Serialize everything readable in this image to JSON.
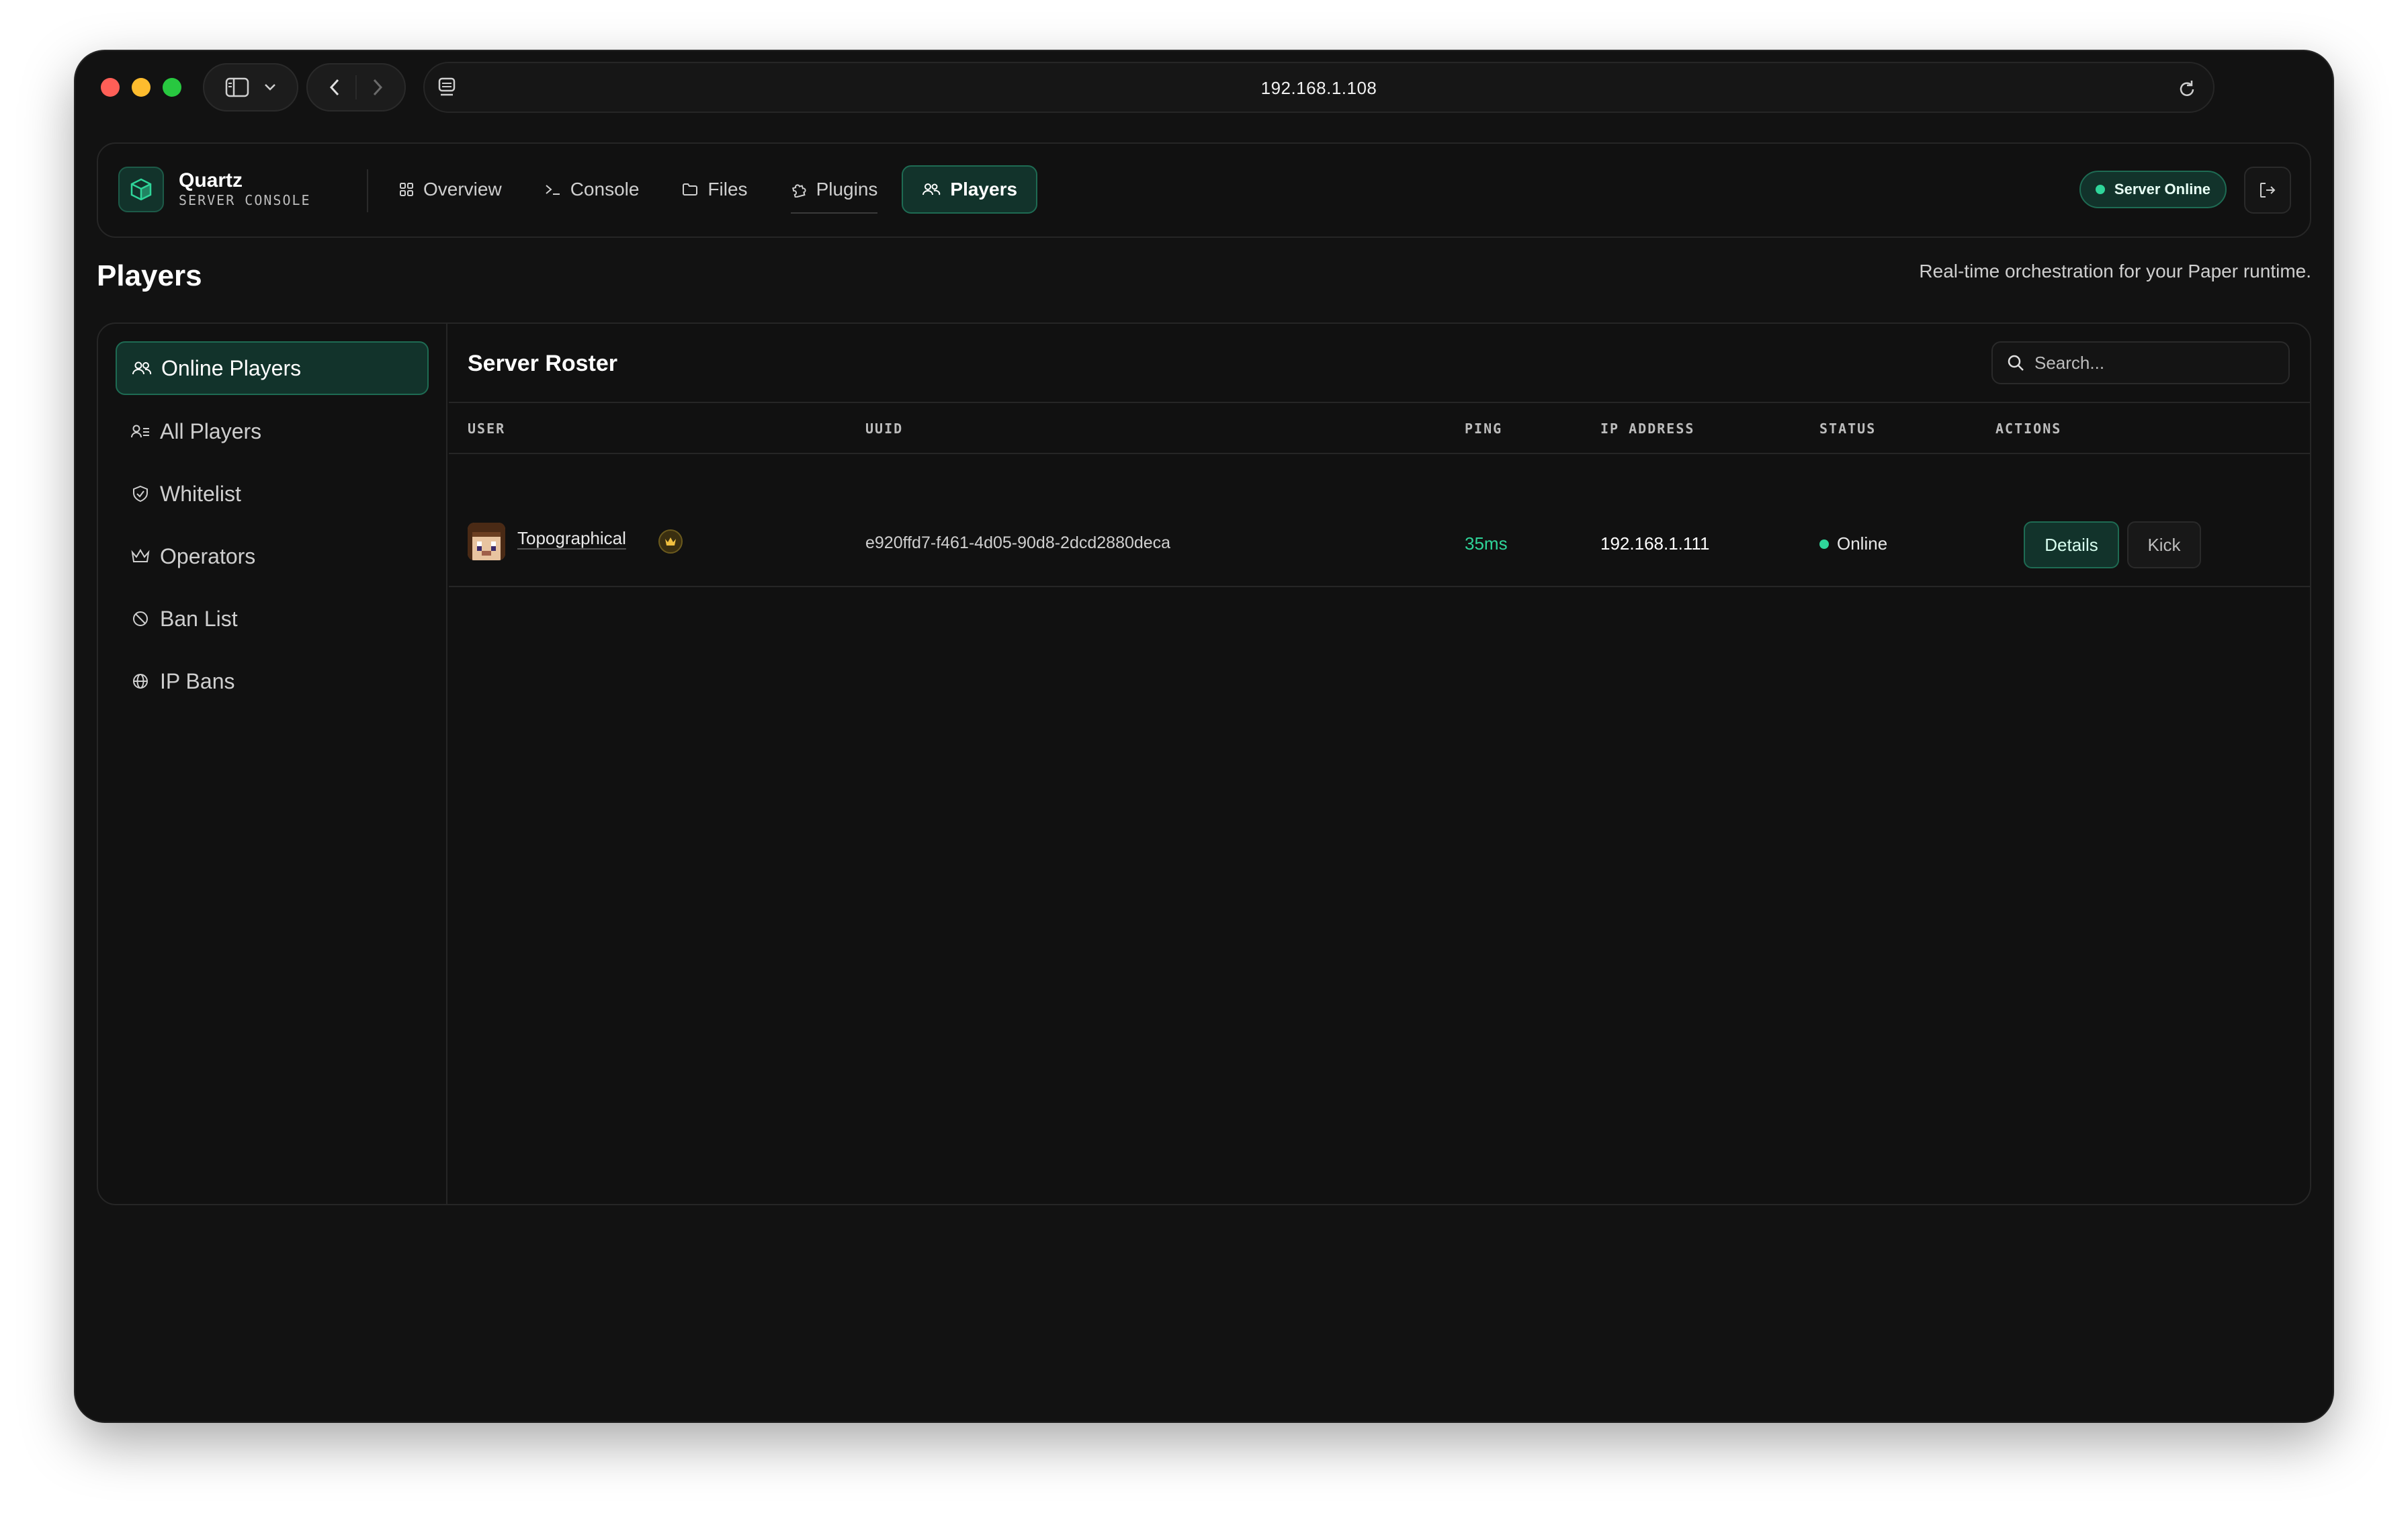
{
  "browser": {
    "address": "192.168.1.108"
  },
  "app": {
    "brand_title": "Quartz",
    "brand_subtitle": "SERVER CONSOLE",
    "nav": [
      {
        "label": "Overview",
        "icon": "grid-icon"
      },
      {
        "label": "Console",
        "icon": "terminal-icon"
      },
      {
        "label": "Files",
        "icon": "folder-icon"
      },
      {
        "label": "Plugins",
        "icon": "puzzle-icon"
      },
      {
        "label": "Players",
        "icon": "users-icon",
        "active": true
      }
    ],
    "server_status": "Server Online",
    "status_color": "#2fd59a",
    "accent_color": "#1e6b53"
  },
  "page": {
    "title": "Players",
    "description": "Real-time orchestration for your Paper runtime."
  },
  "sidebar": {
    "items": [
      {
        "label": "Online Players",
        "icon": "users-icon",
        "active": true
      },
      {
        "label": "All Players",
        "icon": "user-list-icon"
      },
      {
        "label": "Whitelist",
        "icon": "shield-check-icon"
      },
      {
        "label": "Operators",
        "icon": "crown-icon"
      },
      {
        "label": "Ban List",
        "icon": "ban-icon"
      },
      {
        "label": "IP Bans",
        "icon": "globe-icon"
      }
    ]
  },
  "roster": {
    "title": "Server Roster",
    "search_placeholder": "Search...",
    "columns": [
      "USER",
      "UUID",
      "PING",
      "IP ADDRESS",
      "STATUS",
      "ACTIONS"
    ],
    "rows": [
      {
        "user": "Topographical",
        "is_operator": true,
        "uuid": "e920ffd7-f461-4d05-90d8-2dcd2880deca",
        "ping": "35ms",
        "ip": "192.168.1.111",
        "status": "Online",
        "actions": [
          "Details",
          "Kick"
        ]
      }
    ]
  }
}
